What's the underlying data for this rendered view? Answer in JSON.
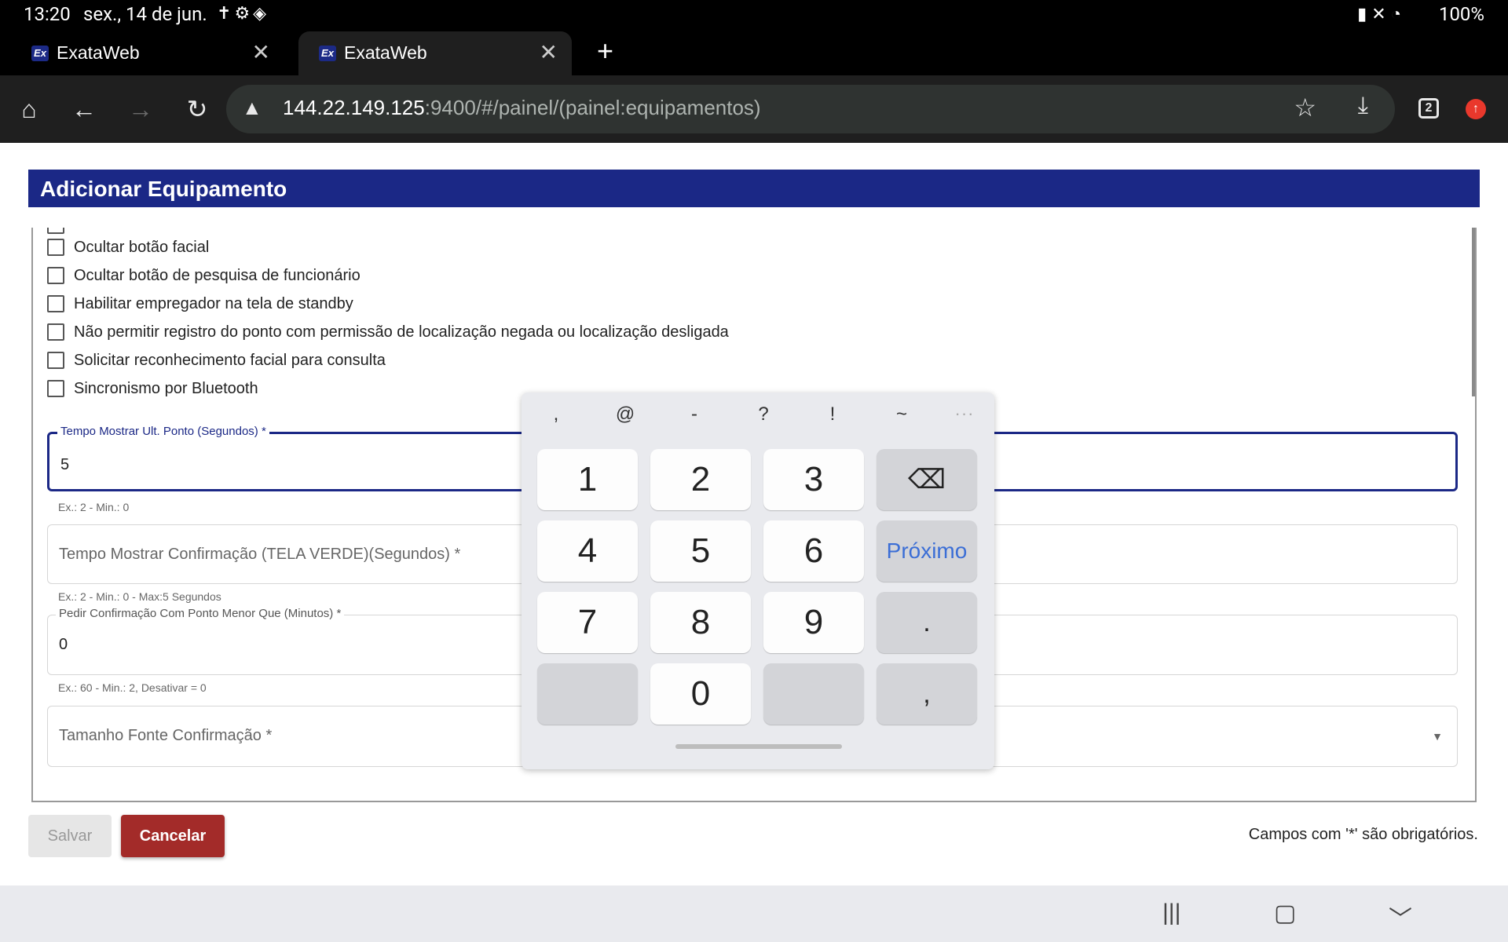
{
  "status_bar": {
    "time": "13:20",
    "date": "sex., 14 de jun.",
    "left_icons": [
      "accessibility-icon",
      "settings-icon",
      "diamond-icon"
    ],
    "right_icons": [
      "battery-saver-icon",
      "mute-icon",
      "wifi-icon"
    ],
    "battery": "100%"
  },
  "tabs": [
    {
      "favicon": "Ex",
      "title": "ExataWeb",
      "active": false
    },
    {
      "favicon": "Ex",
      "title": "ExataWeb",
      "active": true
    }
  ],
  "toolbar": {
    "url_host": "144.22.149.125",
    "url_path": ":9400/#/painel/(painel:equipamentos)",
    "tab_count": "2"
  },
  "modal": {
    "title": "Adicionar Equipamento"
  },
  "checkboxes": [
    {
      "label": "Ocultar botão facial",
      "checked": false
    },
    {
      "label": "Ocultar botão de pesquisa de funcionário",
      "checked": false
    },
    {
      "label": "Habilitar empregador na tela de standby",
      "checked": false
    },
    {
      "label": "Não permitir registro do ponto com permissão de localização negada ou localização desligada",
      "checked": false
    },
    {
      "label": "Solicitar reconhecimento facial para consulta",
      "checked": false
    },
    {
      "label": "Sincronismo por Bluetooth",
      "checked": false
    }
  ],
  "fields": {
    "tempo_ult_ponto": {
      "label": "Tempo Mostrar Ult. Ponto (Segundos) *",
      "value": "5",
      "hint": "Ex.: 2 - Min.: 0"
    },
    "tempo_confirmacao": {
      "placeholder": "Tempo Mostrar Confirmação (TELA VERDE)(Segundos) *",
      "hint": "Ex.: 2 - Min.: 0 - Max:5 Segundos"
    },
    "pedir_confirmacao": {
      "label": "Pedir Confirmação Com Ponto Menor Que (Minutos) *",
      "value": "0",
      "hint": "Ex.: 60 - Min.: 2, Desativar = 0"
    },
    "tamanho_fonte": {
      "placeholder": "Tamanho Fonte Confirmação *"
    }
  },
  "actions": {
    "save": "Salvar",
    "cancel": "Cancelar",
    "required_note": "Campos com '*' são obrigatórios."
  },
  "keyboard": {
    "symbols": [
      ",",
      "@",
      "-",
      "?",
      "!",
      "~",
      "···"
    ],
    "keys": {
      "k1": "1",
      "k2": "2",
      "k3": "3",
      "k4": "4",
      "k5": "5",
      "k6": "6",
      "next": "Próximo",
      "k7": "7",
      "k8": "8",
      "k9": "9",
      "dot": ".",
      "k0": "0",
      "comma": ","
    }
  },
  "colors": {
    "header": "#1b2886",
    "cancel": "#a32b29",
    "keyboard_accent": "#3b6ed6"
  }
}
